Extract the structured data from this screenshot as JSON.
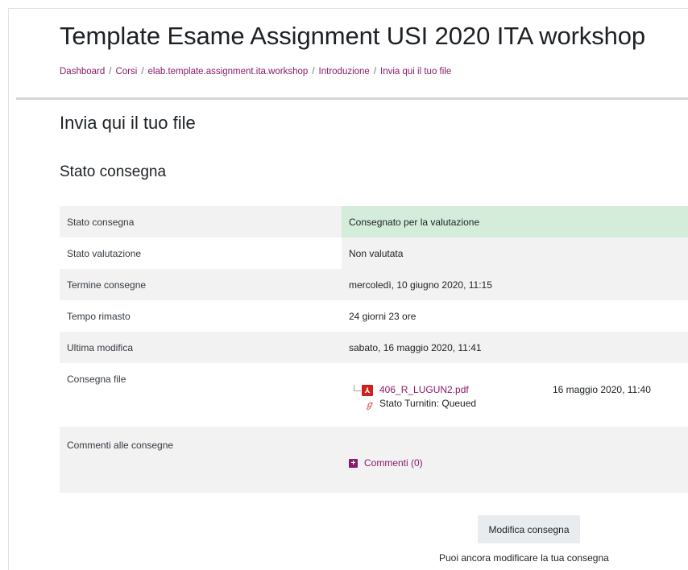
{
  "header": {
    "course_title": "Template Esame Assignment USI 2020 ITA workshop",
    "breadcrumb": [
      "Dashboard",
      "Corsi",
      "elab.template.assignment.ita.workshop",
      "Introduzione",
      "Invia qui il tuo file"
    ]
  },
  "activity": {
    "title": "Invia qui il tuo file",
    "section_title": "Stato consegna"
  },
  "status_table": {
    "rows": [
      {
        "label": "Stato consegna",
        "value": "Consegnato per la valutazione"
      },
      {
        "label": "Stato valutazione",
        "value": "Non valutata"
      },
      {
        "label": "Termine consegne",
        "value": "mercoledì, 10 giugno 2020, 11:15"
      },
      {
        "label": "Tempo rimasto",
        "value": "24 giorni 23 ore"
      },
      {
        "label": "Ultima modifica",
        "value": "sabato, 16 maggio 2020, 11:41"
      }
    ],
    "files_label": "Consegna file",
    "file": {
      "name": "406_R_LUGUN2.pdf",
      "date": "16 maggio 2020, 11:40",
      "turnitin_status": "Stato Turnitin: Queued",
      "icon": "pdf-icon"
    },
    "comments_label": "Commenti alle consegne",
    "comments_link": "Commenti (0)"
  },
  "actions": {
    "edit_button": "Modifica consegna",
    "edit_hint": "Puoi ancora modificare la tua consegna"
  },
  "colors": {
    "link": "#8a1b6a",
    "submitted_bg": "#d4edda",
    "row_alt_bg": "#f2f2f2",
    "pdf_red": "#d0211c"
  }
}
